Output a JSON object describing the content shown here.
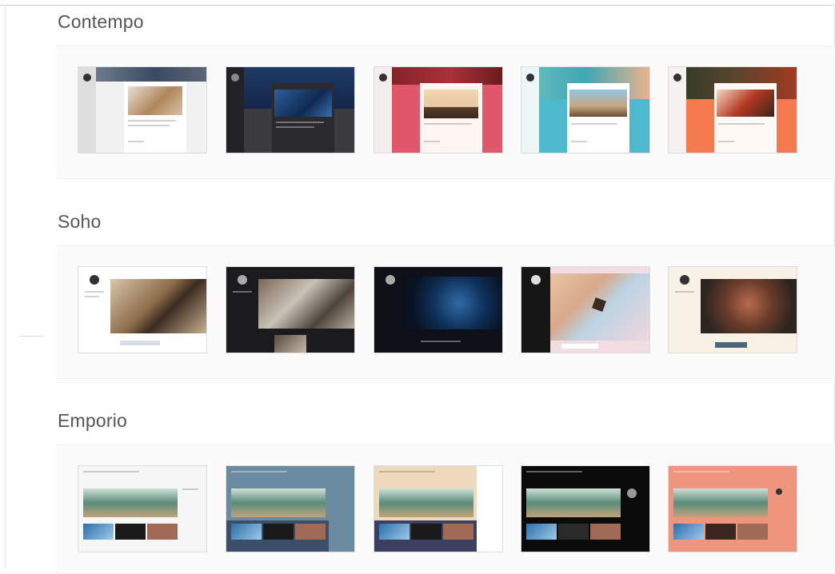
{
  "sections": [
    {
      "title": "Contempo",
      "themes": [
        "contempo-light",
        "contempo-dark",
        "contempo-red",
        "contempo-teal",
        "contempo-orange"
      ]
    },
    {
      "title": "Soho",
      "themes": [
        "soho-light",
        "soho-dark",
        "soho-navy",
        "soho-pink",
        "soho-cream"
      ]
    },
    {
      "title": "Emporio",
      "themes": [
        "emporio-light",
        "emporio-slate",
        "emporio-tan",
        "emporio-black",
        "emporio-salmon"
      ]
    }
  ],
  "colors": {
    "contempo_red": "#e0566a",
    "contempo_teal": "#4cb9cf",
    "contempo_orange": "#f47a4f",
    "emporio_slate": "#6a8ba0",
    "emporio_tan": "#efd9bd",
    "emporio_salmon": "#f0957d"
  }
}
